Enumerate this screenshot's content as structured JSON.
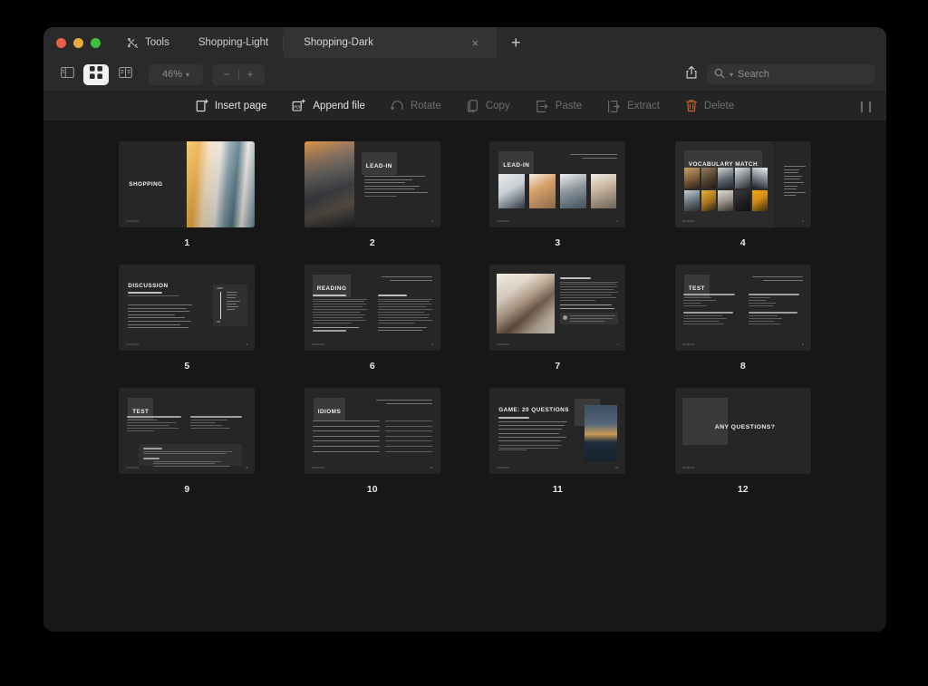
{
  "window": {
    "traffic_lights": [
      "close",
      "minimize",
      "zoom"
    ],
    "traffic_colors": {
      "close": "#e8604c",
      "minimize": "#e8a93c",
      "zoom": "#3dc13d"
    }
  },
  "tabs": {
    "tools_label": "Tools",
    "tools_icon": "tools-icon",
    "items": [
      {
        "label": "Shopping-Light",
        "active": false
      },
      {
        "label": "Shopping-Dark",
        "active": true,
        "close_icon": "close-icon"
      }
    ],
    "new_tab_icon": "plus-icon"
  },
  "toolbar": {
    "view_buttons": [
      {
        "name": "sidebar-view",
        "icon": "sidebar-icon",
        "active": false
      },
      {
        "name": "grid-view",
        "icon": "grid-icon",
        "active": true
      },
      {
        "name": "split-view",
        "icon": "split-view-icon",
        "active": false
      }
    ],
    "zoom_level": "46%",
    "zoom_chevron": "chevron-down-icon",
    "zoom_out": "−",
    "zoom_in": "+",
    "share_icon": "share-icon",
    "search": {
      "placeholder": "Search",
      "value": "",
      "icon": "search-icon",
      "chevron": "chevron-down-icon"
    }
  },
  "actionbar": {
    "actions": [
      {
        "label": "Insert page",
        "icon": "insert-page-icon",
        "enabled": true
      },
      {
        "label": "Append file",
        "icon": "append-file-icon",
        "enabled": true
      },
      {
        "label": "Rotate",
        "icon": "rotate-icon",
        "enabled": false
      },
      {
        "label": "Copy",
        "icon": "copy-icon",
        "enabled": false
      },
      {
        "label": "Paste",
        "icon": "paste-icon",
        "enabled": false
      },
      {
        "label": "Extract",
        "icon": "extract-icon",
        "enabled": false
      },
      {
        "label": "Delete",
        "icon": "trash-icon",
        "enabled": false,
        "accent": "#c9642a"
      }
    ],
    "grip_icon": "grip-icon"
  },
  "document": {
    "page_count": 12,
    "pages": [
      {
        "number": "1",
        "title": "SHOPPING",
        "layout": "title-photo-right"
      },
      {
        "number": "2",
        "title": "LEAD-IN",
        "layout": "photo-left-list-right"
      },
      {
        "number": "3",
        "title": "LEAD-IN",
        "layout": "title-photo-row"
      },
      {
        "number": "4",
        "title": "VOCABULARY MATCH",
        "layout": "photo-grid-wordlist"
      },
      {
        "number": "5",
        "title": "DISCUSSION",
        "subtitle": "How often do you...?",
        "layout": "discussion-scale"
      },
      {
        "number": "6",
        "title": "READING",
        "layout": "two-column-text"
      },
      {
        "number": "7",
        "title": "",
        "layout": "photo-left-text-right"
      },
      {
        "number": "8",
        "title": "TEST",
        "layout": "two-column-quiz"
      },
      {
        "number": "9",
        "title": "TEST",
        "layout": "quiz-with-scoring"
      },
      {
        "number": "10",
        "title": "IDIOMS",
        "layout": "idioms-meanings"
      },
      {
        "number": "11",
        "title": "GAME: 20 QUESTIONS",
        "layout": "game-photo-right"
      },
      {
        "number": "12",
        "title": "ANY QUESTIONS?",
        "layout": "closing"
      }
    ]
  }
}
